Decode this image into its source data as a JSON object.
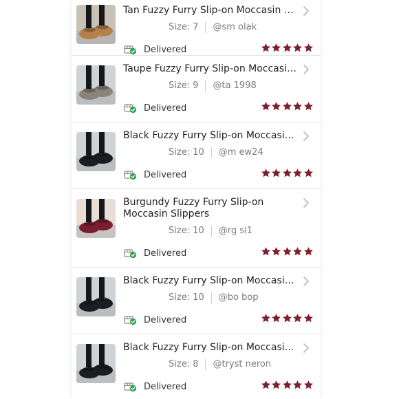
{
  "colors": {
    "star": "#7d1f2c",
    "delivered_check": "#2ea44f",
    "divider": "#e3e3e3",
    "meta_text": "#7a7a7a"
  },
  "orders": [
    {
      "title": "Tan Fuzzy Furry Slip-on Moccasin Sli...",
      "size_label": "Size: 7",
      "buyer": "@sm    olak",
      "status": "Delivered",
      "rating": 5,
      "image": "tan-fuzzy-moccasin-photo",
      "shoe_color": "#b5814a"
    },
    {
      "title": "Taupe Fuzzy Furry Slip-on Moccasin...",
      "size_label": "Size: 9",
      "buyer": "@ta     1998",
      "status": "Delivered",
      "rating": 5,
      "image": "taupe-fuzzy-moccasin-photo",
      "shoe_color": "#8b8278"
    },
    {
      "title": "Black Fuzzy Furry Slip-on Moccasin...",
      "size_label": "Size: 10",
      "buyer": "@m     ew24",
      "status": "Delivered",
      "rating": 5,
      "image": "black-fuzzy-moccasin-photo",
      "shoe_color": "#1a1d22"
    },
    {
      "title": "Burgundy Fuzzy Furry Slip-on Moccasin Slippers",
      "size_label": "Size: 10",
      "buyer": "@rg     si1",
      "status": "Delivered",
      "rating": 5,
      "image": "burgundy-fuzzy-moccasin-photo",
      "shoe_color": "#7a1e2e"
    },
    {
      "title": "Black Fuzzy Furry Slip-on Moccasin...",
      "size_label": "Size: 10",
      "buyer": "@bo     bop",
      "status": "Delivered",
      "rating": 5,
      "image": "black-fuzzy-moccasin-photo",
      "shoe_color": "#1a1d22"
    },
    {
      "title": "Black Fuzzy Furry Slip-on Moccasin...",
      "size_label": "Size: 8",
      "buyer": "@tryst      neron",
      "status": "Delivered",
      "rating": 5,
      "image": "black-fuzzy-moccasin-photo",
      "shoe_color": "#1a1d22"
    }
  ]
}
